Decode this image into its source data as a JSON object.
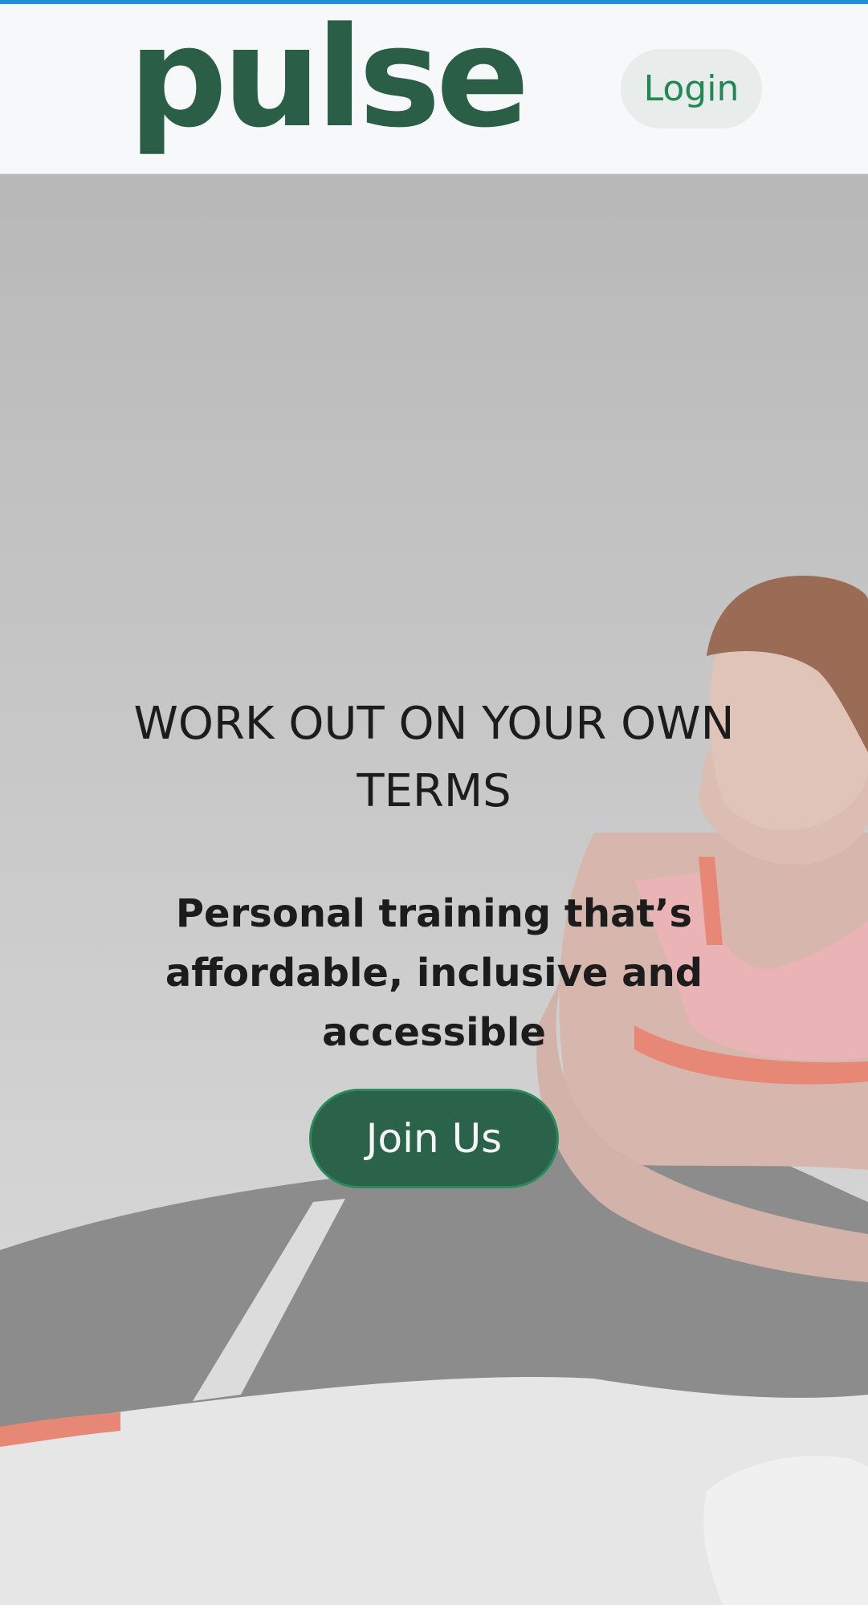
{
  "header": {
    "logo_text": "pulse",
    "login_label": "Login"
  },
  "hero": {
    "headline": "WORK OUT ON YOUR OWN TERMS",
    "subheadline": "Personal training that’s affordable, inclusive and accessible",
    "cta_label": "Join Us"
  },
  "colors": {
    "brand_green": "#2a5e47",
    "accent_blue": "#1e8fe0",
    "login_text": "#238656",
    "cta_background": "#2a624a"
  }
}
